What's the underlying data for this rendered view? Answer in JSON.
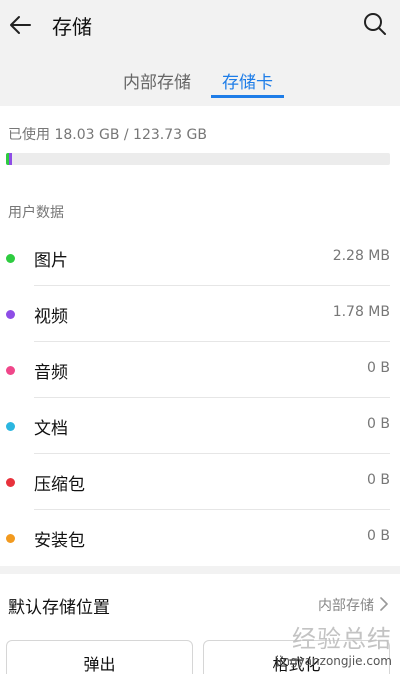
{
  "header": {
    "title": "存储",
    "back_icon": "arrow-left-icon",
    "search_icon": "magnifier-icon"
  },
  "tabs": [
    {
      "label": "内部存储",
      "selected": false
    },
    {
      "label": "存储卡",
      "selected": true
    }
  ],
  "usage": {
    "text": "已使用 18.03 GB / 123.73 GB",
    "used_gb": 18.03,
    "total_gb": 123.73,
    "segments": [
      {
        "color": "#2ecc40",
        "fraction": 0.007
      },
      {
        "color": "#8e4de6",
        "fraction": 0.008
      }
    ]
  },
  "section_label": "用户数据",
  "categories": [
    {
      "name": "图片",
      "size": "2.28 MB",
      "color": "#2ecc40"
    },
    {
      "name": "视频",
      "size": "1.78 MB",
      "color": "#8e4de6"
    },
    {
      "name": "音频",
      "size": "0 B",
      "color": "#f0478a"
    },
    {
      "name": "文档",
      "size": "0 B",
      "color": "#2bb6e0"
    },
    {
      "name": "压缩包",
      "size": "0 B",
      "color": "#e8323c"
    },
    {
      "name": "安装包",
      "size": "0 B",
      "color": "#f29a1f"
    }
  ],
  "default_storage": {
    "label": "默认存储位置",
    "value": "内部存储"
  },
  "buttons": {
    "eject": "弹出",
    "format": "格式化"
  },
  "watermark": {
    "title": "经验总结",
    "url": "jingyanzongjie.com"
  },
  "colors": {
    "accent": "#1e7de8"
  }
}
